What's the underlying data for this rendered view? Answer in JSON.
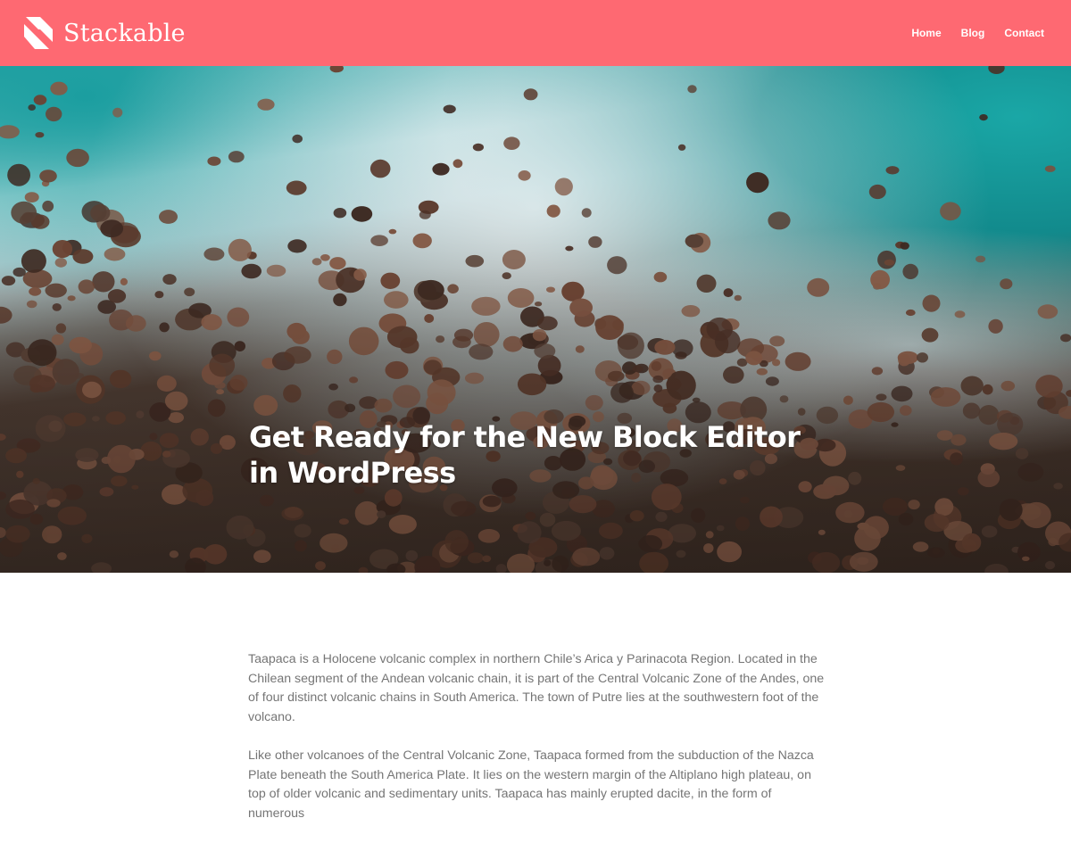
{
  "header": {
    "site_title": "Stackable",
    "logo_icon": "stackable-logo-icon",
    "nav": [
      "Home",
      "Blog",
      "Contact"
    ],
    "background_color": "#fe6972"
  },
  "hero": {
    "title": "Get Ready for the New Block Editor in WordPress",
    "image_description_icon": "rocky-shore-photo"
  },
  "article": {
    "paragraphs": [
      "Taapaca is a Holocene volcanic complex in northern Chile’s Arica y Parinacota Region. Located in the Chilean segment of the Andean volcanic chain, it is part of the Central Volcanic Zone of the Andes, one of four distinct volcanic chains in South America. The town of Putre lies at the southwestern foot of the volcano.",
      "Like other volcanoes of the Central Volcanic Zone, Taapaca formed from the subduction of the Nazca Plate beneath the South America Plate. It lies on the western margin of the Altiplano high plateau, on top of older volcanic and sedimentary units. Taapaca has mainly erupted dacite, in the form of numerous"
    ]
  }
}
